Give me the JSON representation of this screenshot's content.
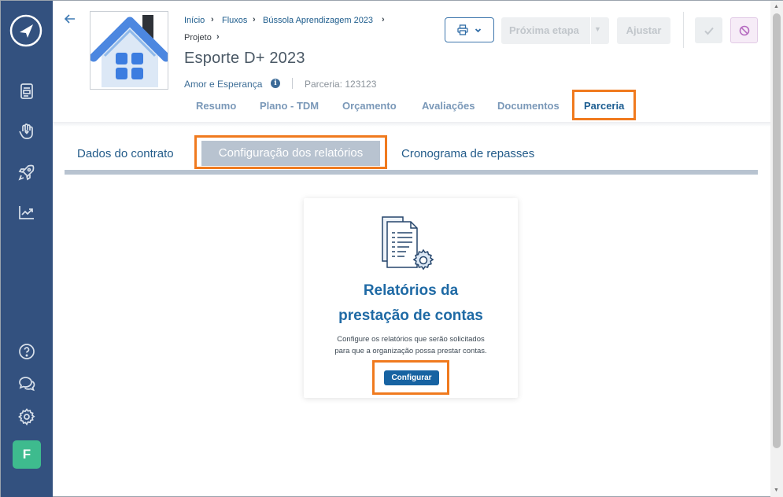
{
  "breadcrumb": {
    "items": [
      "Início",
      "Fluxos",
      "Bússola Aprendizagem 2023"
    ],
    "sub": "Projeto"
  },
  "project": {
    "title": "Esporte D+ 2023",
    "organization": "Amor e Esperança",
    "parceria": "Parceria: 123123"
  },
  "tabs": [
    "Resumo",
    "Plano - TDM",
    "Orçamento",
    "Avaliações",
    "Documentos",
    "Parceria"
  ],
  "active_tab": "Parceria",
  "toolbar": {
    "next_step": "Próxima etapa",
    "adjust": "Ajustar"
  },
  "subtabs": [
    "Dados do contrato",
    "Configuração dos relatórios",
    "Cronograma de repasses"
  ],
  "card": {
    "title_line1": "Relatórios da",
    "title_line2": "prestação de contas",
    "desc_line1": "Configure os relatórios que serão solicitados",
    "desc_line2": "para que a organização possa prestar contas.",
    "button": "Configurar"
  },
  "user": {
    "initial": "F"
  },
  "colors": {
    "sidebar": "#33517f",
    "accent": "#1763a2",
    "highlight": "#f07a1e",
    "avatar": "#3ebb8e"
  },
  "icons": [
    "logo-icon",
    "document-icon",
    "hand-heart-icon",
    "rocket-icon",
    "chart-icon",
    "help-icon",
    "chat-icon",
    "settings-icon"
  ]
}
